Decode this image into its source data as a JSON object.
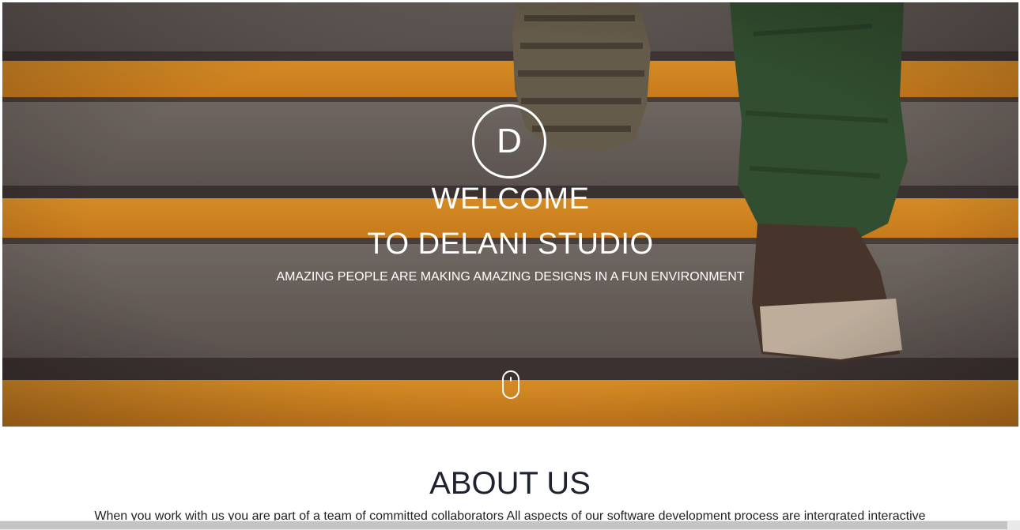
{
  "hero": {
    "logo_letter": "D",
    "title_line1": "WELCOME",
    "title_line2": "TO DELANI STUDIO",
    "subtitle": "AMAZING PEOPLE ARE MAKING AMAZING DESIGNS IN A FUN ENVIRONMENT",
    "scroll_icon": "mouse-scroll-icon",
    "background_image": "person-climbing-stairs-photo"
  },
  "about": {
    "title": "ABOUT US",
    "text": "When you work with us you are part of a team of committed collaborators All aspects of our software development process are intergrated interactive"
  },
  "colors": {
    "stair_stripe": "#f39a1f",
    "stair_concrete": "#7a786f",
    "heading_text": "#1f2330",
    "hero_text": "#ffffff"
  }
}
